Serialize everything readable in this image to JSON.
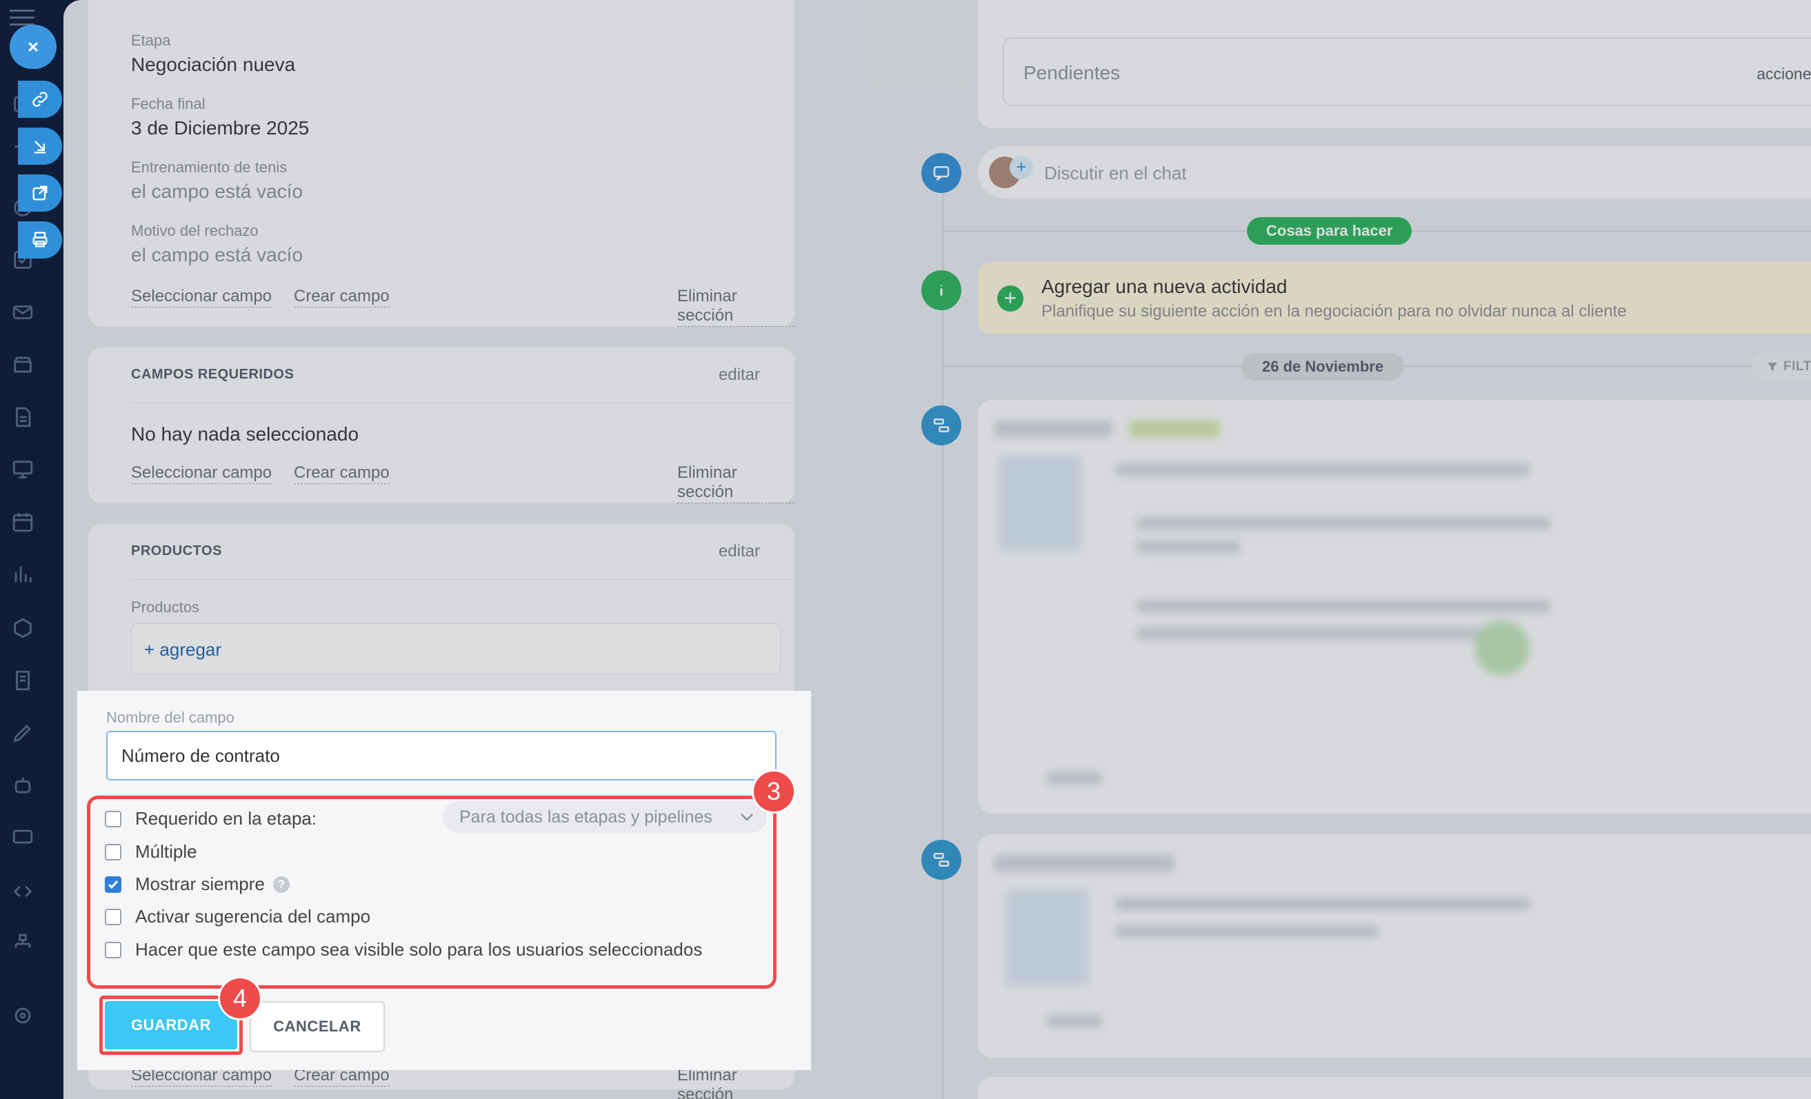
{
  "nav": {
    "menu_icon": "hamburger-icon",
    "actions": [
      "close-icon",
      "link-icon",
      "download-icon",
      "external-link-icon",
      "print-icon"
    ]
  },
  "left": {
    "stage": {
      "label": "Etapa",
      "value": "Negociación nueva"
    },
    "end_date": {
      "label": "Fecha final",
      "value": "3 de Diciembre 2025"
    },
    "tennis": {
      "label": "Entrenamiento de tenis",
      "value": "el campo está vacío"
    },
    "reject": {
      "label": "Motivo del rechazo",
      "value": "el campo está vacío"
    },
    "links": {
      "select": "Seleccionar campo",
      "create": "Crear campo",
      "delete": "Eliminar sección"
    },
    "required": {
      "title": "CAMPOS REQUERIDOS",
      "edit": "editar",
      "empty": "No hay nada seleccionado"
    },
    "products": {
      "title": "PRODUCTOS",
      "edit": "editar",
      "label": "Productos",
      "add": "+ agregar"
    }
  },
  "editor": {
    "field_name_label": "Nombre del campo",
    "field_name_value": "Número de contrato",
    "options": {
      "required": {
        "label": "Requerido en la etapa:",
        "checked": false
      },
      "multiple": {
        "label": "Múltiple",
        "checked": false
      },
      "always_show": {
        "label": "Mostrar siempre",
        "checked": true
      },
      "suggest": {
        "label": "Activar sugerencia del campo",
        "checked": false
      },
      "visible_selected": {
        "label": "Hacer que este campo sea visible solo para los usuarios seleccionados",
        "checked": false
      }
    },
    "stage_select": "Para todas las etapas y pipelines",
    "help": "?",
    "step3": "3",
    "step4": "4",
    "save": "GUARDAR",
    "cancel": "CANCELAR",
    "highlight_color": "#ef4b4b"
  },
  "timeline": {
    "pending_placeholder": "Pendientes",
    "actions": "acciones",
    "chat_placeholder": "Discutir en el chat",
    "todo_badge": "Cosas para hacer",
    "new_activity_title": "Agregar una nueva actividad",
    "new_activity_desc": "Planifique su siguiente acción en la negociación para no olvidar nunca al cliente",
    "date_badge": "26 de Noviembre",
    "filter": "FILTRO"
  }
}
